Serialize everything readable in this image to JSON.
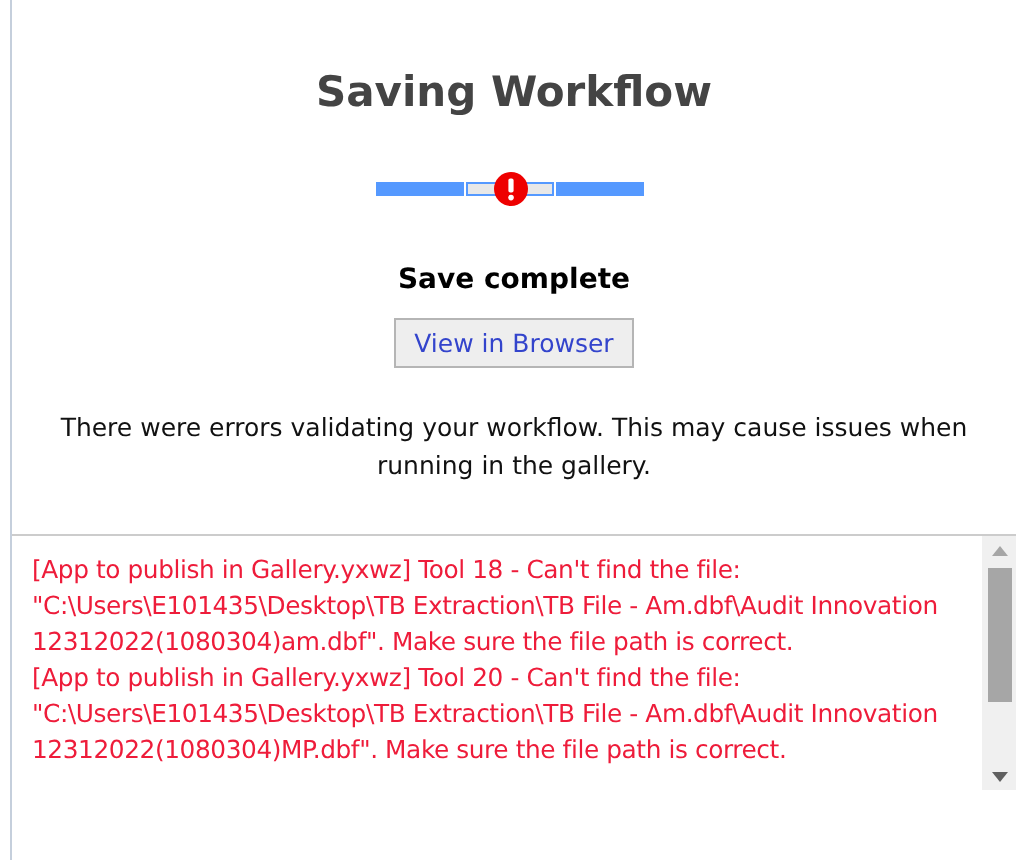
{
  "title": "Saving Workflow",
  "progress": {
    "steps": [
      {
        "error": false
      },
      {
        "error": true
      },
      {
        "error": false
      }
    ]
  },
  "status": "Save complete",
  "view_button": "View in Browser",
  "message": "There were errors validating your workflow. This may cause issues when running in the gallery.",
  "log": [
    {
      "error": true,
      "text": "[App to publish in Gallery.yxwz] Tool 18 - Can't find the file: \"C:\\Users\\E101435\\Desktop\\TB Extraction\\TB File - Am.dbf\\Audit Innovation 12312022(1080304)am.dbf\". Make sure the file path is correct."
    },
    {
      "error": true,
      "text": "[App to publish in Gallery.yxwz] Tool 20 - Can't find the file: \"C:\\Users\\E101435\\Desktop\\TB Extraction\\TB File - Am.dbf\\Audit Innovation 12312022(1080304)MP.dbf\". Make sure the file path is correct."
    }
  ]
}
